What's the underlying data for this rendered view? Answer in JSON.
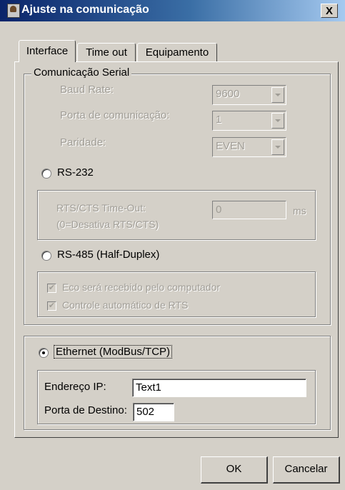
{
  "window": {
    "title": "Ajuste na comunicação",
    "close_label": "X"
  },
  "tabs": [
    {
      "label": "Interface",
      "active": true
    },
    {
      "label": "Time out",
      "active": false
    },
    {
      "label": "Equipamento",
      "active": false
    }
  ],
  "serial": {
    "group_label": "Comunicação Serial",
    "baud_rate": {
      "label": "Baud Rate:",
      "value": "9600"
    },
    "porta": {
      "label": "Porta de comunicação:",
      "value": "1"
    },
    "paridade": {
      "label": "Paridade:",
      "value": "EVEN"
    },
    "rs232": {
      "label": "RS-232",
      "selected": false,
      "timeout_label_line1": "RTS/CTS Time-Out:",
      "timeout_label_line2": "(0=Desativa RTS/CTS)",
      "timeout_value": "0",
      "timeout_unit": "ms"
    },
    "rs485": {
      "label": "RS-485 (Half-Duplex)",
      "selected": false,
      "eco_label": "Eco será recebido pelo computador",
      "eco_checked": true,
      "rts_label": "Controle automático de RTS",
      "rts_checked": true
    }
  },
  "ethernet": {
    "label": "Ethernet (ModBus/TCP)",
    "selected": true,
    "ip_label": "Endereço IP:",
    "ip_value": "Text1",
    "port_label": "Porta de Destino:",
    "port_value": "502"
  },
  "buttons": {
    "ok": "OK",
    "cancel": "Cancelar"
  }
}
